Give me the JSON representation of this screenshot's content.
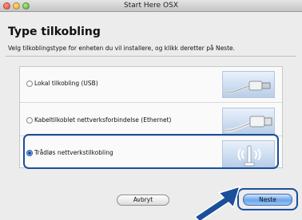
{
  "window": {
    "title": "Start Here OSX"
  },
  "page": {
    "title": "Type tilkobling",
    "instruction": "Velg tilkoblingstype for enheten du vil installere, og klikk deretter på Neste."
  },
  "options": [
    {
      "label": "Lokal tilkobling (USB)",
      "selected": false,
      "icon": "usb-cable-icon"
    },
    {
      "label": "Kabeltilkoblet nettverksforbindelse (Ethernet)",
      "selected": false,
      "icon": "ethernet-cable-icon"
    },
    {
      "label": "Trådløs nettverkstilkobling",
      "selected": true,
      "icon": "wireless-access-point-icon"
    }
  ],
  "buttons": {
    "cancel": "Avbryt",
    "next": "Neste"
  },
  "colors": {
    "highlight": "#1a4f9a",
    "default_button": "#6aa5ea"
  }
}
